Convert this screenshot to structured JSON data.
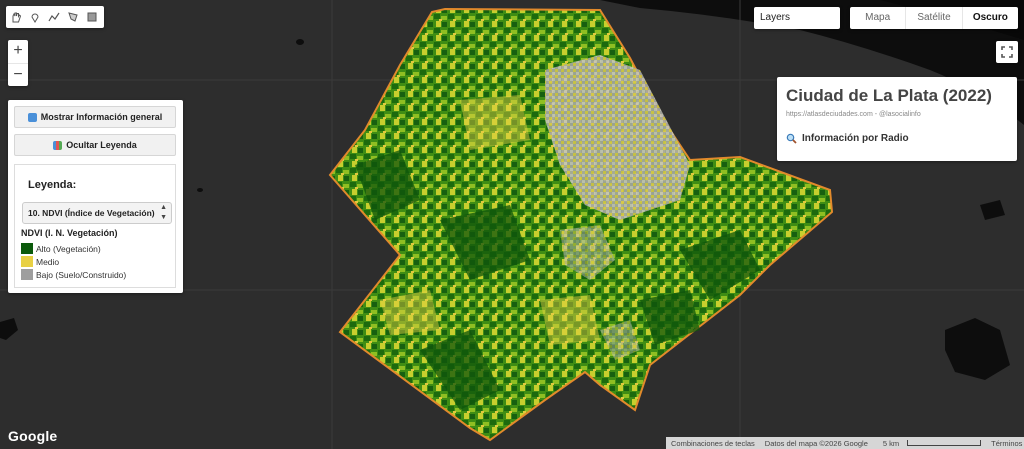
{
  "map": {
    "colors": {
      "background": "#2d2d2d",
      "water": "#0d0d0d",
      "boundary": "#e28a2b",
      "ndvi_high": "#0b5a0b",
      "ndvi_mid": "#e8d044",
      "ndvi_low": "#9e9e9e"
    }
  },
  "toolbar": {
    "tools": [
      "hand-icon",
      "marker-icon",
      "polyline-icon",
      "polygon-icon",
      "rectangle-icon"
    ]
  },
  "layers": {
    "label": "Layers"
  },
  "map_type": {
    "options": [
      "Mapa",
      "Satélite",
      "Oscuro"
    ],
    "selected": "Oscuro"
  },
  "zoom": {
    "in": "+",
    "out": "−"
  },
  "panel": {
    "show_info_button": "Mostrar Información general",
    "hide_legend_button": "Ocultar Leyenda",
    "legend": {
      "title": "Leyenda:",
      "selected_layer": "10. NDVI (Índice de Vegetación)",
      "section_title": "NDVI (I. N. Vegetación)",
      "items": [
        {
          "label": "Alto (Vegetación)",
          "color": "#0b5a0b"
        },
        {
          "label": "Medio",
          "color": "#e8d044"
        },
        {
          "label": "Bajo (Suelo/Construido)",
          "color": "#9e9e9e"
        }
      ]
    }
  },
  "info_box": {
    "title": "Ciudad de La Plata (2022)",
    "subtitle": "https://atlasdeciudades.com - @lasocialinfo",
    "link": "Información por Radio"
  },
  "attribution": {
    "logo": "Google",
    "shortcuts": "Combinaciones de teclas",
    "map_data": "Datos del mapa ©2026 Google",
    "scale": "5 km",
    "terms": "Términos"
  }
}
